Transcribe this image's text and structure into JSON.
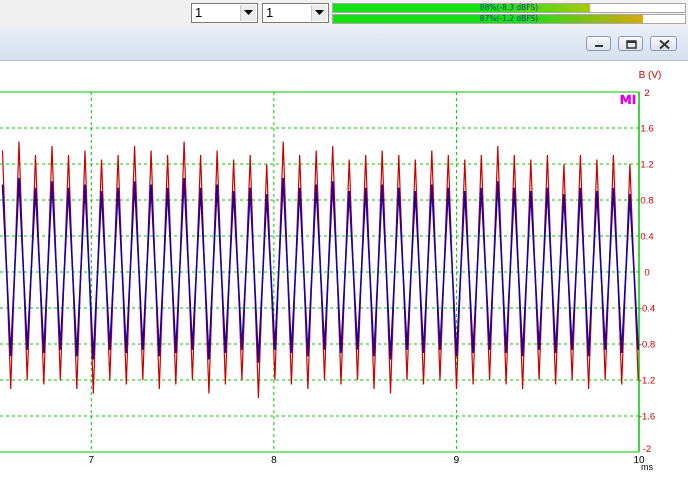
{
  "toolbar": {
    "combo1_value": "1",
    "combo2_value": "1",
    "meter1": {
      "label": "88%(-8.3 dBFS)",
      "level": 0.73,
      "colors": [
        "#14e014",
        "#a9c812"
      ]
    },
    "meter2": {
      "label": "87%(-1.2 dBFS)",
      "level": 0.88,
      "colors": [
        "#14e014",
        "#d8a810"
      ]
    }
  },
  "window_controls": [
    "minimize-icon",
    "restore-icon",
    "close-icon"
  ],
  "colors": {
    "grid": "#00c800",
    "trace_upper": "#cc0000",
    "trace_core": "#1a00a0",
    "axis_label": "#cc0000",
    "marker": "#e000e0"
  },
  "chart_data": {
    "type": "line",
    "ylabel": "B (V)",
    "xlabel": "ms",
    "marker_label": "MI",
    "x_range": [
      6.5,
      10
    ],
    "ylim": [
      -2,
      2
    ],
    "x_ticks": [
      "7",
      "8",
      "9",
      "10"
    ],
    "y_ticks": [
      "2",
      "1.6",
      "1.2",
      "0.8",
      "0.4",
      "0",
      "-0.4",
      "-0.8",
      "-1.2",
      "-1.6",
      "-2"
    ],
    "grid": true,
    "series": [
      {
        "peaks": [
          1.35,
          1.45,
          1.3,
          1.4,
          1.3,
          1.35,
          1.25,
          1.3,
          1.4,
          1.35,
          1.3,
          1.45,
          1.3,
          1.35,
          1.25,
          1.3,
          1.2,
          1.45,
          1.3,
          1.35,
          1.4,
          1.25,
          1.3,
          1.35,
          1.3,
          1.25,
          1.35,
          1.3,
          1.25,
          1.3,
          1.4,
          1.3,
          1.25,
          1.3,
          1.2,
          1.3,
          1.25,
          1.3,
          1.2
        ],
        "troughs": [
          -1.3,
          -1.2,
          -1.25,
          -1.2,
          -1.3,
          -1.35,
          -1.2,
          -1.25,
          -1.2,
          -1.3,
          -1.25,
          -1.2,
          -1.35,
          -1.25,
          -1.2,
          -1.4,
          -1.2,
          -1.25,
          -1.3,
          -1.2,
          -1.25,
          -1.2,
          -1.3,
          -1.35,
          -1.2,
          -1.25,
          -1.2,
          -1.3,
          -1.25,
          -1.2,
          -1.25,
          -1.3,
          -1.2,
          -1.25,
          -1.2,
          -1.3,
          -1.2,
          -1.25,
          -1.2
        ]
      }
    ]
  }
}
